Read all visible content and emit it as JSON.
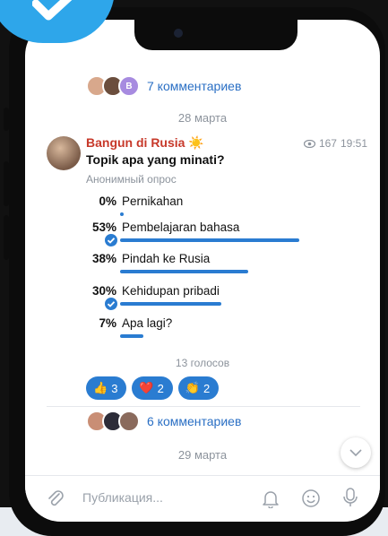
{
  "thread_top": {
    "comments_label": "7 комментариев",
    "avatar_badge": "B"
  },
  "date_1": "28 марта",
  "post": {
    "author": "Bangun di Rusia",
    "author_emoji": "☀️",
    "views": "167",
    "time": "19:51",
    "question": "Topik apa yang minati?",
    "poll_type": "Анонимный опрос",
    "options": [
      {
        "percent": "0%",
        "label": "Pernikahan",
        "value": 0,
        "checked": false
      },
      {
        "percent": "53%",
        "label": "Pembelajaran bahasa",
        "value": 53,
        "checked": true
      },
      {
        "percent": "38%",
        "label": "Pindah ke Rusia",
        "value": 38,
        "checked": false
      },
      {
        "percent": "30%",
        "label": "Kehidupan pribadi",
        "value": 30,
        "checked": true
      },
      {
        "percent": "7%",
        "label": "Apa lagi?",
        "value": 7,
        "checked": false
      }
    ],
    "votes": "13 голосов",
    "reactions": [
      {
        "emoji": "👍",
        "count": "3"
      },
      {
        "emoji": "❤️",
        "count": "2"
      },
      {
        "emoji": "👏",
        "count": "2"
      }
    ],
    "comments_label": "6 комментариев"
  },
  "date_2": "29 марта",
  "composer": {
    "placeholder": "Публикация..."
  },
  "colors": {
    "accent": "#2a7cd1",
    "author": "#c7392a",
    "muted": "#8c939c"
  }
}
